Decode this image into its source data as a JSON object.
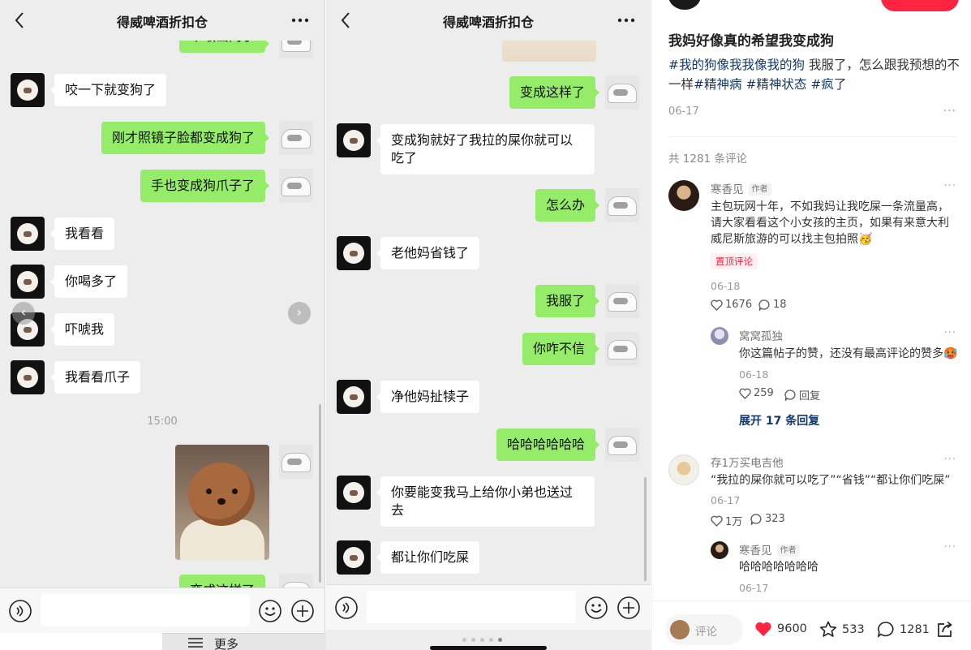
{
  "chat": {
    "title": "得威啤酒折扣仓",
    "time_label": "15:00",
    "left_messages": [
      {
        "from": "me",
        "text": "不敢出门了"
      },
      {
        "from": "them",
        "text": "咬一下就变狗了"
      },
      {
        "from": "me",
        "text": "刚才照镜子脸都变成狗了"
      },
      {
        "from": "me",
        "text": "手也变成狗爪子了"
      },
      {
        "from": "them",
        "text": "我看看"
      },
      {
        "from": "them",
        "text": "你喝多了"
      },
      {
        "from": "them",
        "text": "吓唬我"
      },
      {
        "from": "them",
        "text": "我看看爪子"
      },
      {
        "from": "me",
        "text": "变成这样了"
      }
    ],
    "mid_messages": [
      {
        "from": "me",
        "text": "变成这样了"
      },
      {
        "from": "them",
        "text": "变成狗就好了我拉的屎你就可以吃了"
      },
      {
        "from": "me",
        "text": "怎么办"
      },
      {
        "from": "them",
        "text": "老他妈省钱了"
      },
      {
        "from": "me",
        "text": "我服了"
      },
      {
        "from": "me",
        "text": "你咋不信"
      },
      {
        "from": "them",
        "text": "净他妈扯犊子"
      },
      {
        "from": "me",
        "text": "哈哈哈哈哈哈"
      },
      {
        "from": "them",
        "text": "你要能变我马上给你小弟也送过去"
      },
      {
        "from": "them",
        "text": "都让你们吃屎"
      }
    ],
    "more_tab_label": "更多",
    "icons": [
      "back-icon",
      "more-dots-icon",
      "voice-icon",
      "emoji-icon",
      "plus-icon",
      "menu-lines-icon"
    ]
  },
  "post": {
    "title": "我妈好像真的希望我变成狗",
    "body_tag1": "#我的狗像我我像我的狗",
    "body_text": " 我服了，怎么跟我预想的不一样",
    "body_tag2": "#精神病",
    "body_tag3": " #精神状态",
    "body_tag4": " #疯了",
    "date": "06-17",
    "more": "···",
    "comment_count": "共 1281 条评论",
    "comments": [
      {
        "name": "寒香见",
        "author_tag": "作者",
        "text": "主包玩网十年，不如我妈让我吃屎一条流量高，请大家看看这个小女孩的主页，如果有来意大利威尼斯旅游的可以找主包拍照🥳",
        "pin": "置顶评论",
        "date": "06-18",
        "likes": "1676",
        "replies": "18"
      },
      {
        "name": "窝窝孤独",
        "text": "你这篇帖子的赞，还没有最高评论的赞多🥵",
        "date": "06-18",
        "likes": "259",
        "reply_label": "回复"
      },
      {
        "expand": "展开 17 条回复"
      },
      {
        "name": "存1万买电吉他",
        "text": "“我拉的屎你就可以吃了”“省钱”“都让你们吃屎”",
        "date": "06-17",
        "likes": "1万",
        "replies": "323"
      },
      {
        "name": "寒香见",
        "author_tag": "作者",
        "text": "哈哈哈哈哈哈哈",
        "date": "06-17"
      }
    ],
    "bottom": {
      "placeholder": "评论",
      "likes": "9600",
      "stars": "533",
      "comments": "1281"
    },
    "colors": {
      "accent": "#ff2442",
      "tag": "#13386c",
      "bubble_out": "#95ec69"
    }
  }
}
